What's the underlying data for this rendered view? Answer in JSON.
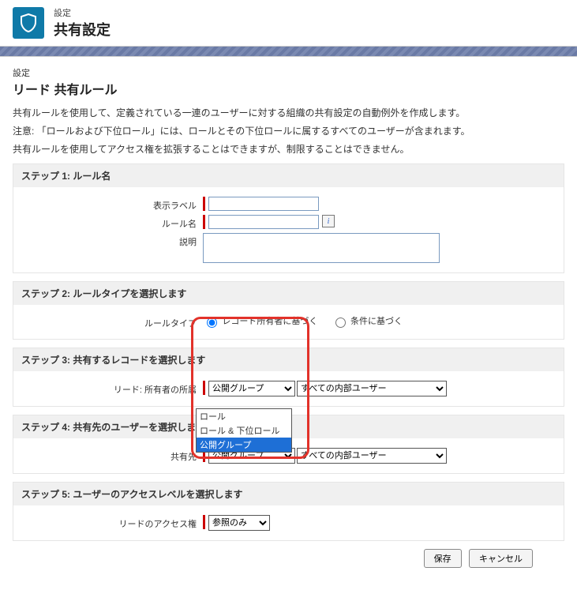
{
  "header": {
    "breadcrumb": "設定",
    "title": "共有設定"
  },
  "page": {
    "breadcrumb": "設定",
    "title": "リード 共有ルール",
    "desc1": "共有ルールを使用して、定義されている一連のユーザーに対する組織の共有設定の自動例外を作成します。",
    "desc2": "注意: 「ロールおよび下位ロール」には、ロールとその下位ロールに属するすべてのユーザーが含まれます。",
    "desc3": "共有ルールを使用してアクセス権を拡張することはできますが、制限することはできません。"
  },
  "step1": {
    "heading": "ステップ 1: ルール名",
    "label_display": "表示ラベル",
    "label_rulename": "ルール名",
    "label_desc": "説明",
    "display_value": "",
    "rulename_value": "",
    "desc_value": ""
  },
  "step2": {
    "heading": "ステップ 2: ルールタイプを選択します",
    "label": "ルールタイプ",
    "opt1": "レコード所有者に基づく",
    "opt2": "条件に基づく"
  },
  "step3": {
    "heading": "ステップ 3: 共有するレコードを選択します",
    "label": "リード: 所有者の所属",
    "sel1": "公開グループ",
    "sel2": "すべての内部ユーザー"
  },
  "step4": {
    "heading": "ステップ 4: 共有先のユーザーを選択します",
    "label": "共有先",
    "sel1": "公開グループ",
    "sel2": "すべての内部ユーザー",
    "dropdown": {
      "o1": "ロール",
      "o2": "ロール & 下位ロール",
      "o3": "公開グループ"
    }
  },
  "step5": {
    "heading": "ステップ 5: ユーザーのアクセスレベルを選択します",
    "label": "リードのアクセス権",
    "sel": "参照のみ"
  },
  "buttons": {
    "save": "保存",
    "cancel": "キャンセル"
  }
}
